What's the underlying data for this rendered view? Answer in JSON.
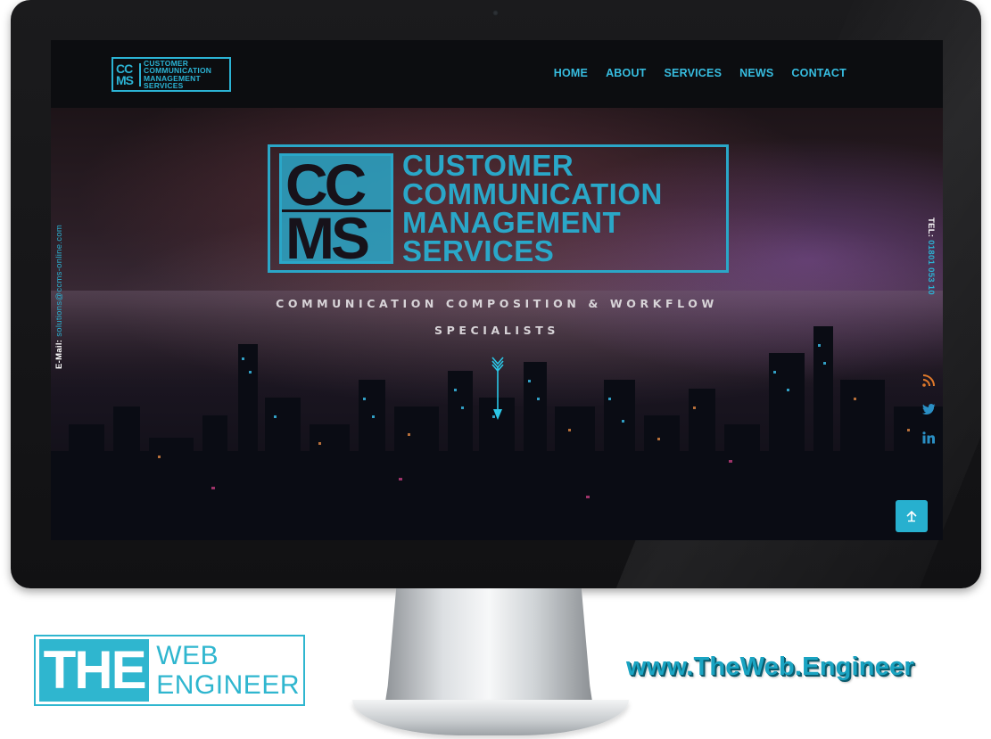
{
  "header": {
    "logo": {
      "mark": [
        "CC",
        "MS"
      ],
      "lines": [
        "CUSTOMER",
        "COMMUNICATION",
        "MANAGEMENT",
        "SERVICES"
      ]
    },
    "nav": [
      "HOME",
      "ABOUT",
      "SERVICES",
      "NEWS",
      "CONTACT"
    ]
  },
  "hero": {
    "logo": {
      "mark": [
        "CC",
        "MS"
      ],
      "lines": [
        "CUSTOMER",
        "COMMUNICATION",
        "MANAGEMENT",
        "SERVICES"
      ]
    },
    "tagline": [
      "COMMUNICATION COMPOSITION & WORKFLOW",
      "SPECIALISTS"
    ],
    "side_email": {
      "label": "E-Mail:",
      "value": "solutions@ccms-online.com"
    },
    "side_tel": {
      "label": "TEL:",
      "value": "01801 053 10"
    },
    "social_icons": [
      "rss-icon",
      "twitter-icon",
      "linkedin-icon"
    ],
    "scroll_icon": "arrow-down-icon",
    "back_to_top_icon": "arrow-up-icon"
  },
  "branding": {
    "logo_the": "THE",
    "logo_words": [
      "WEB",
      "ENGINEER"
    ],
    "url": "www.TheWeb.Engineer"
  },
  "colors": {
    "accent": "#2bb3d4",
    "header_bg": "#0c0d10",
    "brand": "#2fb6cf"
  }
}
